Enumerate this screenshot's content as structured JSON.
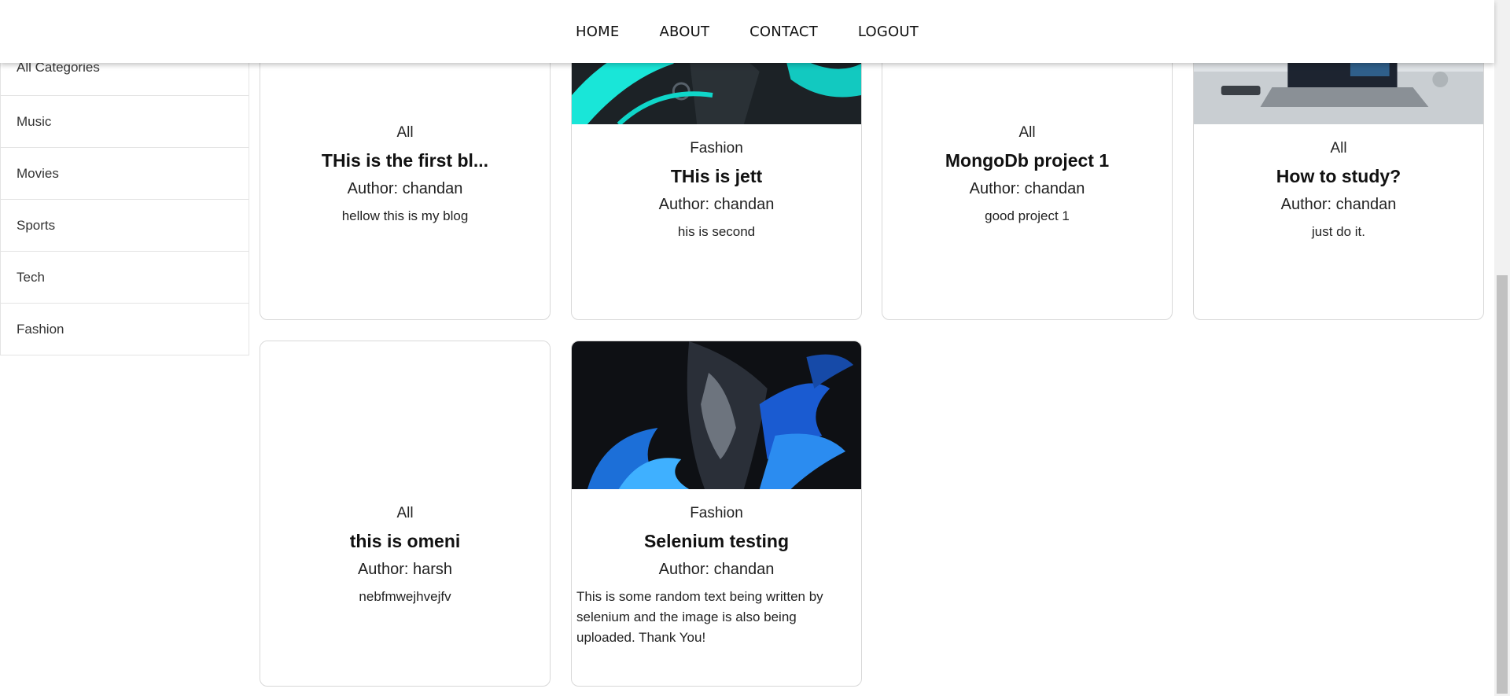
{
  "nav": {
    "items": [
      "HOME",
      "ABOUT",
      "CONTACT",
      "LOGOUT"
    ]
  },
  "sidebar": {
    "categories": [
      "All Categories",
      "Music",
      "Movies",
      "Sports",
      "Tech",
      "Fashion"
    ]
  },
  "posts": [
    {
      "category": "All",
      "title": "THis is the first bl...",
      "author": "Author: chandan",
      "description": "hellow this is my blog",
      "image": "none"
    },
    {
      "category": "Fashion",
      "title": "THis is jett",
      "author": "Author: chandan",
      "description": "his is second",
      "image": "dark-cyan-character-art"
    },
    {
      "category": "All",
      "title": "MongoDb project 1",
      "author": "Author: chandan",
      "description": "good project 1",
      "image": "none"
    },
    {
      "category": "All",
      "title": "How to study?",
      "author": "Author: chandan",
      "description": "just do it.",
      "image": "laptop-desk-photo"
    },
    {
      "category": "All",
      "title": "this is omeni",
      "author": "Author: harsh",
      "description": "nebfmwejhvejfv",
      "image": "none"
    },
    {
      "category": "Fashion",
      "title": "Selenium testing",
      "author": "Author: chandan",
      "description": "This is some random text being written by selenium and the image is also being uploaded. Thank You!",
      "image": "dark-blue-flame-character-art"
    }
  ],
  "colors": {
    "nav_bg": "#ffffff",
    "card_border": "#d8d8d8",
    "scroll_thumb": "#c1c1c1"
  }
}
